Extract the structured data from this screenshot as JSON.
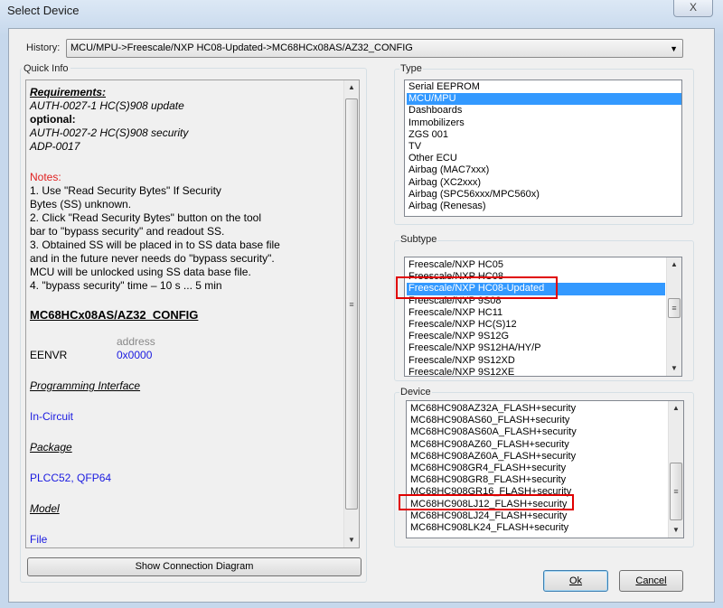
{
  "window": {
    "title": "Select Device",
    "close_label": "X"
  },
  "history": {
    "label": "History:",
    "value": "MCU/MPU->Freescale/NXP HC08-Updated->MC68HCx08AS/AZ32_CONFIG"
  },
  "quick_info": {
    "label": "Quick Info",
    "requirements_title": "Requirements:",
    "req1": "AUTH-0027-1 HC(S)908  update",
    "optional": "optional:",
    "opt1": "AUTH-0027-2 HC(S)908  security",
    "opt2": "ADP-0017",
    "notes_title": "Notes:",
    "notes": [
      "1. Use \"Read Security Bytes\" If Security",
      "Bytes (SS) unknown.",
      "2. Click \"Read Security Bytes\" button on the tool",
      "bar to \"bypass security\" and readout SS.",
      "3. Obtained SS will be placed in to SS data base file",
      "and in the future never needs do \"bypass security\".",
      "MCU will be unlocked using SS data base file.",
      "4. \"bypass security\" time – 10 s ... 5 min"
    ],
    "config_title": "MC68HCx08AS/AZ32_CONFIG",
    "address_header": "address",
    "reg_name": "EENVR",
    "reg_address": "0x0000",
    "prog_if_title": "Programming Interface",
    "prog_if_value": "In-Circuit",
    "package_title": "Package",
    "package_value": "PLCC52, QFP64",
    "model_title": "Model",
    "model_value": "File"
  },
  "show_diagram_label": "Show Connection Diagram",
  "type": {
    "label": "Type",
    "items": [
      "Serial EEPROM",
      "MCU/MPU",
      "Dashboards",
      "Immobilizers",
      "ZGS 001",
      "TV",
      "Other ECU",
      "Airbag (MAC7xxx)",
      "Airbag (XC2xxx)",
      "Airbag (SPC56xxx/MPC560x)",
      "Airbag (Renesas)"
    ],
    "selected": 1
  },
  "subtype": {
    "label": "Subtype",
    "items": [
      "Freescale/NXP HC05",
      "Freescale/NXP HC08",
      "Freescale/NXP HC08-Updated",
      "Freescale/NXP 9S08",
      "Freescale/NXP HC11",
      "Freescale/NXP HC(S)12",
      "Freescale/NXP 9S12G",
      "Freescale/NXP 9S12HA/HY/P",
      "Freescale/NXP 9S12XD",
      "Freescale/NXP 9S12XE"
    ],
    "selected": 2,
    "highlighted": 2
  },
  "device": {
    "label": "Device",
    "items": [
      "MC68HC908AZ32A_FLASH+security",
      "MC68HC908AS60_FLASH+security",
      "MC68HC908AS60A_FLASH+security",
      "MC68HC908AZ60_FLASH+security",
      "MC68HC908AZ60A_FLASH+security",
      "MC68HC908GR4_FLASH+security",
      "MC68HC908GR8_FLASH+security",
      "MC68HC908GR16_FLASH+security",
      "MC68HC908LJ12_FLASH+security",
      "MC68HC908LJ24_FLASH+security",
      "MC68HC908LK24_FLASH+security"
    ],
    "highlighted": 8
  },
  "buttons": {
    "ok": "Ok",
    "cancel": "Cancel"
  },
  "colors": {
    "selection": "#3399ff",
    "highlight_box": "#e00000",
    "notes": "#e02020",
    "values": "#1a1ae0"
  }
}
